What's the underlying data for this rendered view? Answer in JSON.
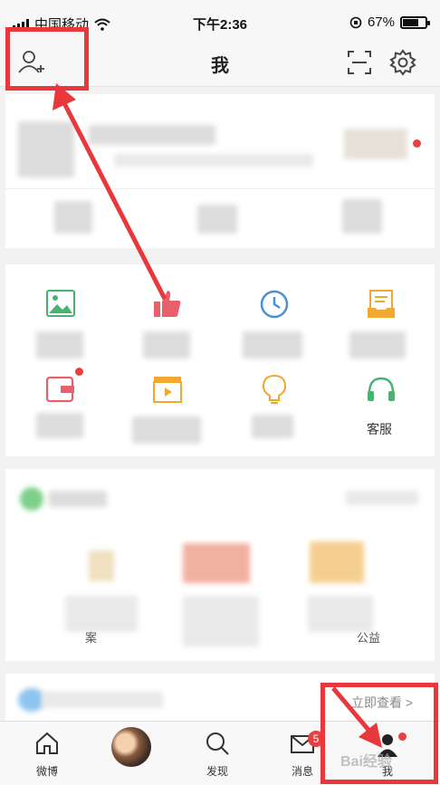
{
  "status_bar": {
    "carrier": "中国移动",
    "time": "下午2:36",
    "battery": "67%",
    "battery_level": 0.67
  },
  "nav": {
    "title": "我"
  },
  "function_grid": [
    {
      "label": "",
      "icon": "image-icon"
    },
    {
      "label": "",
      "icon": "thumbs-up-icon"
    },
    {
      "label": "",
      "icon": "clock-icon"
    },
    {
      "label": "",
      "icon": "drafts-icon"
    },
    {
      "label": "",
      "icon": "wallet-icon"
    },
    {
      "label": "",
      "icon": "video-clapper-icon"
    },
    {
      "label": "",
      "icon": "lightbulb-icon"
    },
    {
      "label": "客服",
      "icon": "headset-icon"
    }
  ],
  "welfare": {
    "item_left": "案",
    "item_right": "公益"
  },
  "promo": {
    "link": "立即查看 >"
  },
  "tabbar": {
    "tabs": [
      {
        "label": "微博",
        "icon": "home-icon"
      },
      {
        "label": "",
        "icon": "avatar"
      },
      {
        "label": "发现",
        "icon": "search-icon"
      },
      {
        "label": "消息",
        "icon": "mail-icon",
        "badge": "5"
      },
      {
        "label": "我",
        "icon": "person-icon"
      }
    ]
  },
  "watermark": "Bai经验"
}
